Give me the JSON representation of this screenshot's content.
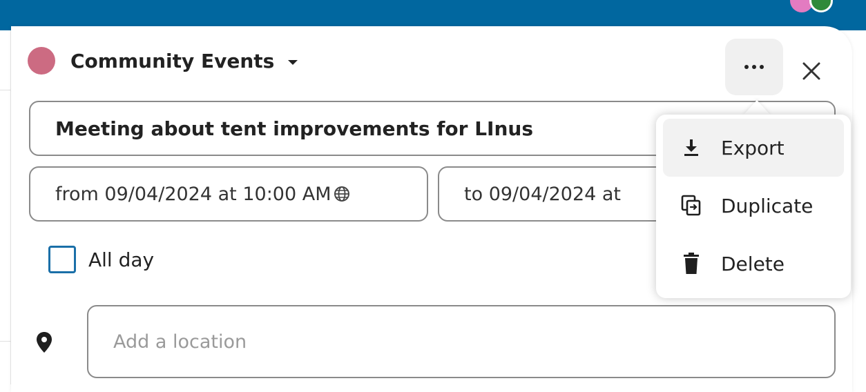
{
  "calendar": {
    "name": "Community Events",
    "color": "#cc6b82"
  },
  "header_actions": {
    "more_icon": "more-horizontal-icon",
    "close_icon": "close-icon"
  },
  "event": {
    "title": "Meeting about tent improvements for LInus",
    "from": "from 09/04/2024 at 10:00 AM",
    "to": "to 09/04/2024 at",
    "timezone_icon": "globe-icon"
  },
  "all_day": {
    "label": "All day",
    "checked": false
  },
  "location": {
    "placeholder": "Add a location",
    "icon": "map-pin-icon"
  },
  "menu": {
    "items": [
      {
        "label": "Export",
        "icon": "download-icon"
      },
      {
        "label": "Duplicate",
        "icon": "duplicate-icon"
      },
      {
        "label": "Delete",
        "icon": "trash-icon"
      }
    ]
  },
  "colors": {
    "header": "#01679f",
    "checkbox": "#1a6fa8"
  }
}
